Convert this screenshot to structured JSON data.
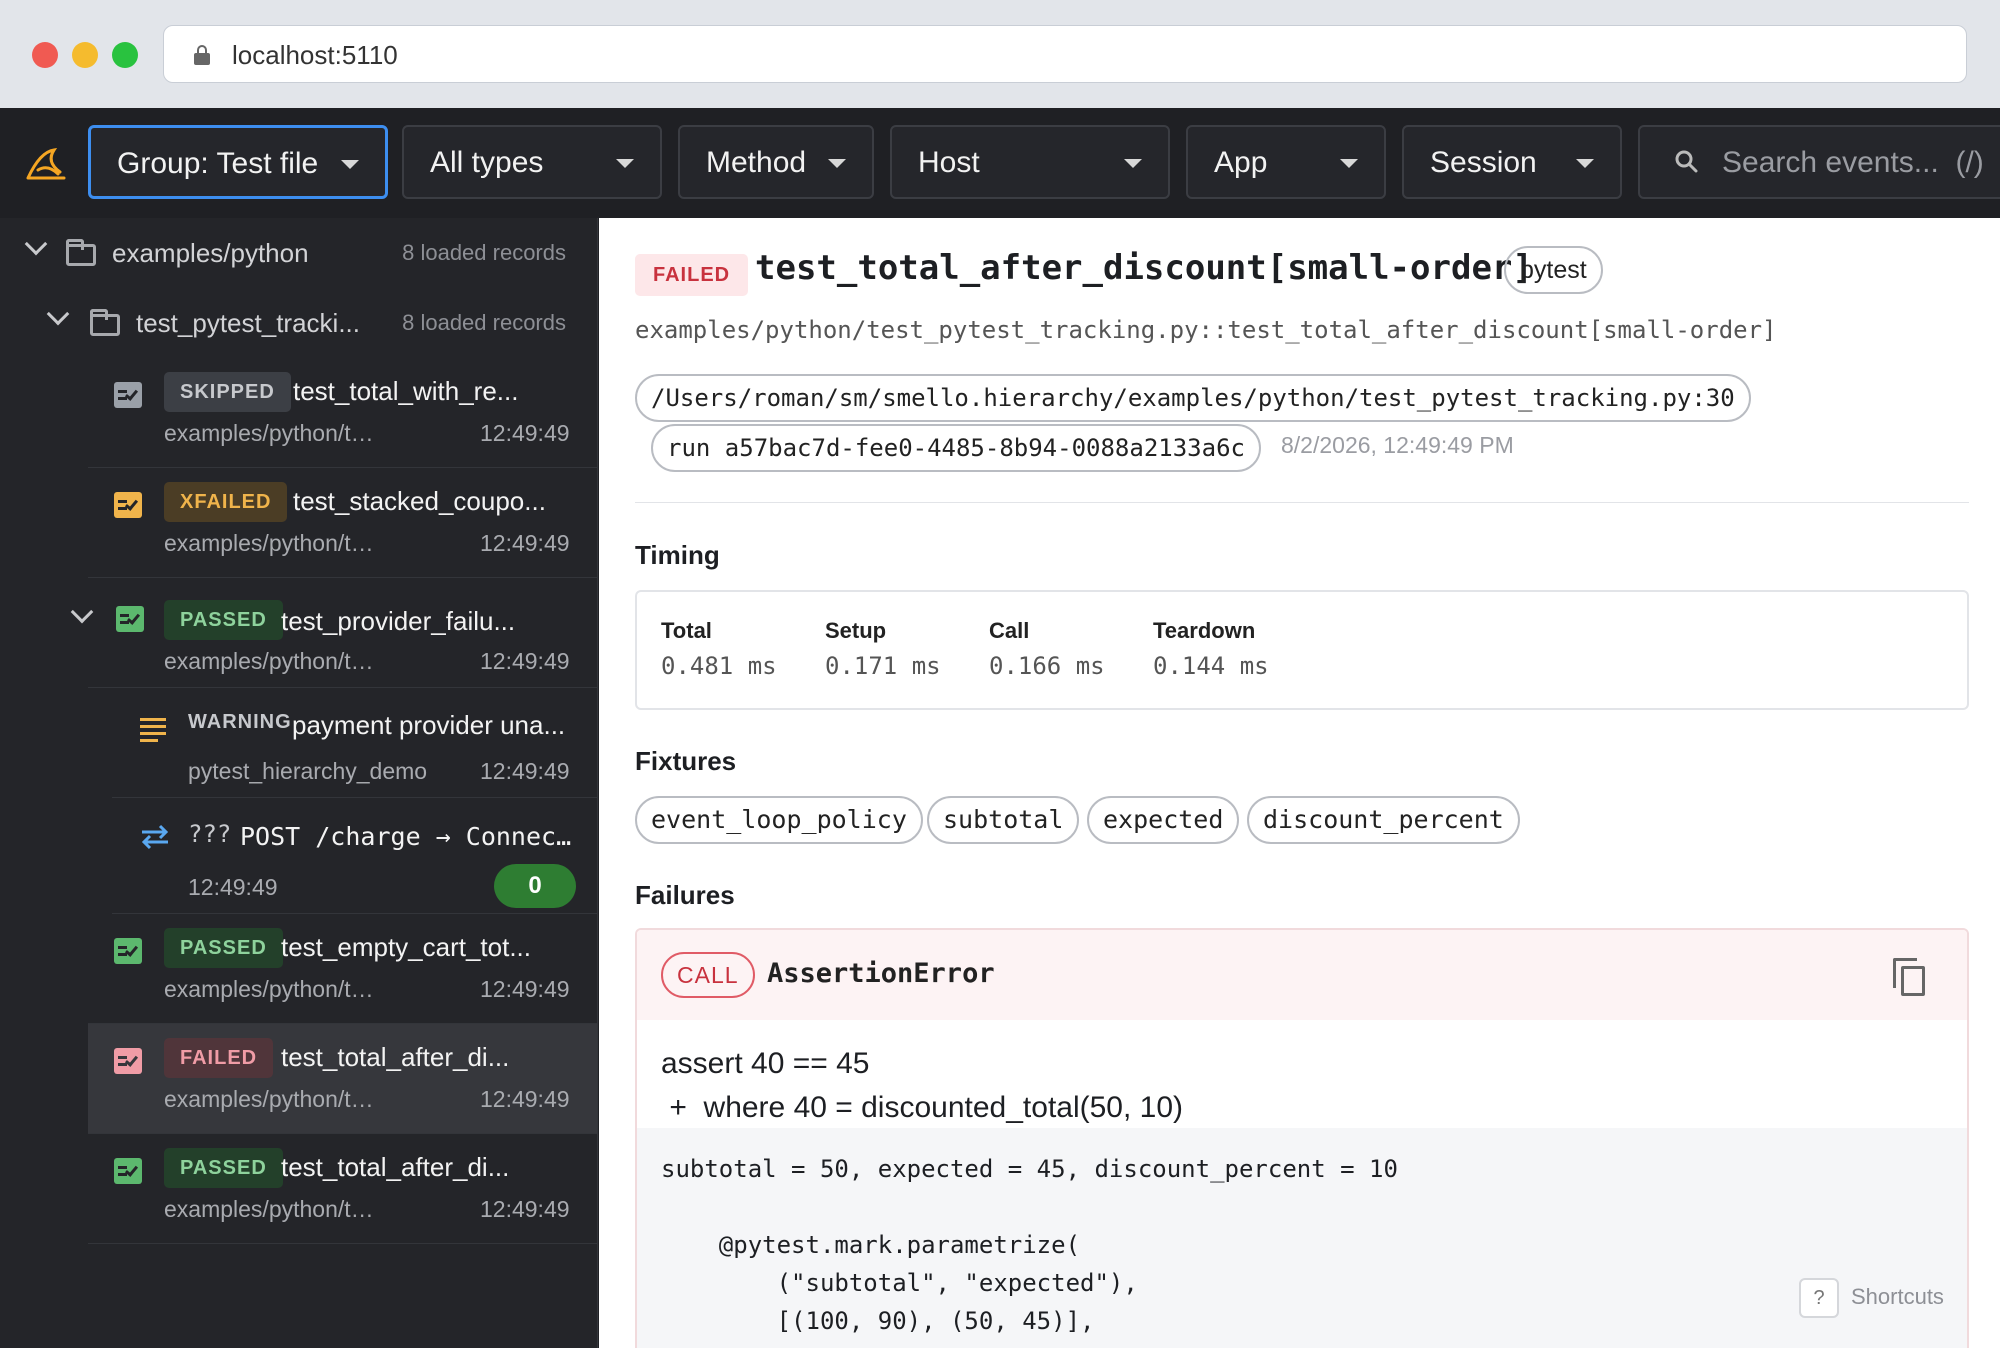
{
  "browser": {
    "url": "localhost:5110"
  },
  "toolbar": {
    "group_label": "Group: Test file",
    "types_label": "All types",
    "method_label": "Method",
    "host_label": "Host",
    "app_label": "App",
    "session_label": "Session",
    "search_placeholder": "Search events...",
    "search_shortcut": "(/)"
  },
  "sidebar": {
    "groups": [
      {
        "name": "examples/python",
        "count": "8 loaded records"
      },
      {
        "name": "test_pytest_tracki...",
        "count": "8 loaded records"
      }
    ],
    "items": [
      {
        "status": "SKIPPED",
        "title": "test_total_with_re...",
        "path": "examples/python/test_...",
        "time": "12:49:49"
      },
      {
        "status": "XFAILED",
        "title": "test_stacked_coupo...",
        "path": "examples/python/test_...",
        "time": "12:49:49"
      },
      {
        "status": "PASSED",
        "title": "test_provider_failu...",
        "path": "examples/python/test_...",
        "time": "12:49:49"
      },
      {
        "status": "WARNING",
        "title": "payment provider una...",
        "path": "pytest_hierarchy_demo",
        "time": "12:49:49"
      },
      {
        "method": "???",
        "title": "POST /charge → Connect...",
        "time": "12:49:49",
        "count": "0"
      },
      {
        "status": "PASSED",
        "title": "test_empty_cart_tot...",
        "path": "examples/python/test_...",
        "time": "12:49:49"
      },
      {
        "status": "FAILED",
        "title": "test_total_after_di...",
        "path": "examples/python/test_...",
        "time": "12:49:49"
      },
      {
        "status": "PASSED",
        "title": "test_total_after_di...",
        "path": "examples/python/test_...",
        "time": "12:49:49"
      }
    ]
  },
  "detail": {
    "status": "FAILED",
    "title": "test_total_after_discount[small-order]",
    "framework": "pytest",
    "nodeid": "examples/python/test_pytest_tracking.py::test_total_after_discount[small-order]",
    "file_path": "/Users/roman/sm/smello.hierarchy/examples/python/test_pytest_tracking.py:30",
    "run_id": "run a57bac7d-fee0-4485-8b94-0088a2133a6c",
    "datetime": "8/2/2026, 12:49:49 PM",
    "timing_title": "Timing",
    "timing": [
      {
        "label": "Total",
        "value": "0.481 ms"
      },
      {
        "label": "Setup",
        "value": "0.171 ms"
      },
      {
        "label": "Call",
        "value": "0.166 ms"
      },
      {
        "label": "Teardown",
        "value": "0.144 ms"
      }
    ],
    "fixtures_title": "Fixtures",
    "fixtures": [
      "event_loop_policy",
      "subtotal",
      "expected",
      "discount_percent"
    ],
    "failures_title": "Failures",
    "failure": {
      "phase": "CALL",
      "error": "AssertionError",
      "message_line1": "assert 40 == 45",
      "message_line2": " +  where 40 = discounted_total(50, 10)",
      "code": "subtotal = 50, expected = 45, discount_percent = 10\n\n    @pytest.mark.parametrize(\n        (\"subtotal\", \"expected\"),\n        [(100, 90), (50, 45)],"
    },
    "shortcuts_key": "?",
    "shortcuts_label": "Shortcuts"
  },
  "colors": {
    "accent": "#3d8ef0",
    "failed": "#c8323e",
    "passed": "#5cb86e",
    "xfailed": "#f0b44b",
    "count_badge": "#2e7d32"
  }
}
